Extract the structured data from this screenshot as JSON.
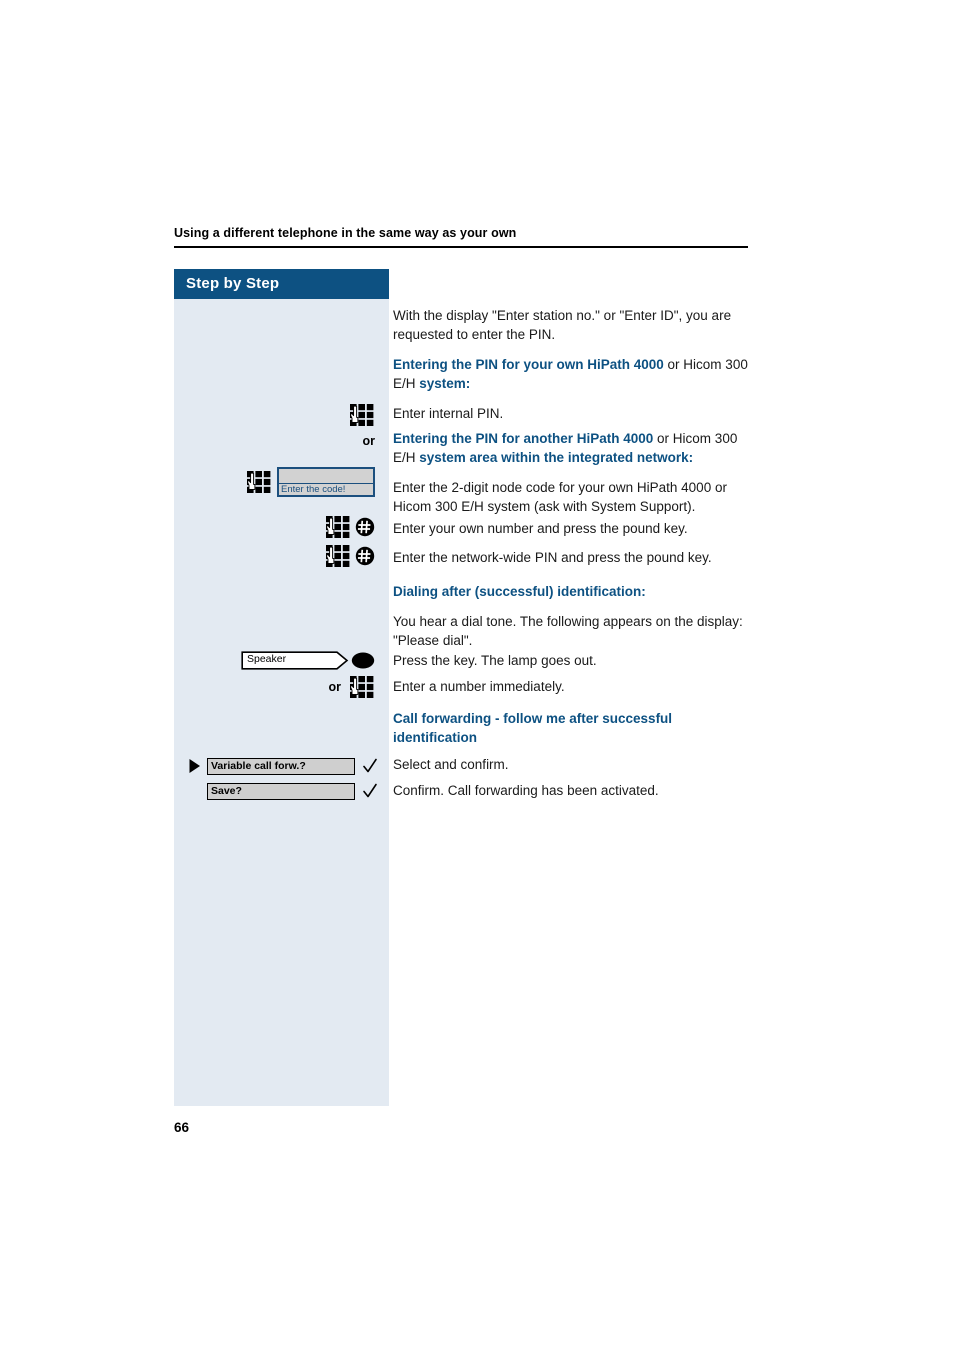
{
  "header": {
    "running_title": "Using a different telephone in the same way as your own"
  },
  "sidebar": {
    "banner_label": "Step by Step"
  },
  "page_number": "66",
  "steps": [
    {
      "icon": "keypad-icon",
      "or_label": "or",
      "display_text": null,
      "text_id": "enter_internal_pin"
    }
  ],
  "left_column": {
    "or_label_1": "or",
    "or_label_2": "or",
    "display_box_text": "Enter the code!",
    "speaker_label": "Speaker",
    "softkey_1_label": "Variable call forw.?",
    "softkey_2_label": "Save?"
  },
  "body": {
    "intro": "With the display \"Enter station no.\" or \"Enter ID\", you are requested to enter the PIN.",
    "heading_own_pin_bold_1": "Entering the PIN for your own HiPath 4000",
    "heading_own_pin_plain": " or Hicom 300 E/H ",
    "heading_own_pin_bold_2": "system:",
    "enter_internal_pin": "Enter internal PIN.",
    "heading_other_pin_bold_1": "Entering the PIN for another HiPath 4000",
    "heading_other_pin_plain": " or Hicom 300 E/H ",
    "heading_other_pin_bold_2": "system area within the integrated network:",
    "node_code": "Enter the 2-digit node code for your own HiPath 4000 or Hicom 300 E/H system (ask with System Support).",
    "own_number": "Enter your own number and press the pound key.",
    "network_pin": "Enter the network-wide PIN and press the pound key.",
    "heading_dialing": "Dialing after (successful) identification:",
    "dial_tone": "You hear a dial tone. The following appears on the display: \"Please dial\".",
    "press_key": "Press the key. The lamp goes out.",
    "enter_number": "Enter a number immediately.",
    "heading_call_forwarding": "Call forwarding - follow me after successful identification",
    "select_confirm": "Select and confirm.",
    "confirm_activated": "Confirm. Call forwarding has been activated."
  },
  "colors": {
    "accent_blue": "#0d5182",
    "sidebar_bg": "#e3eaf2",
    "softkey_gray": "#cfcfcf",
    "display_gray": "#d2d2d2",
    "display_border": "#1b4f7e"
  }
}
